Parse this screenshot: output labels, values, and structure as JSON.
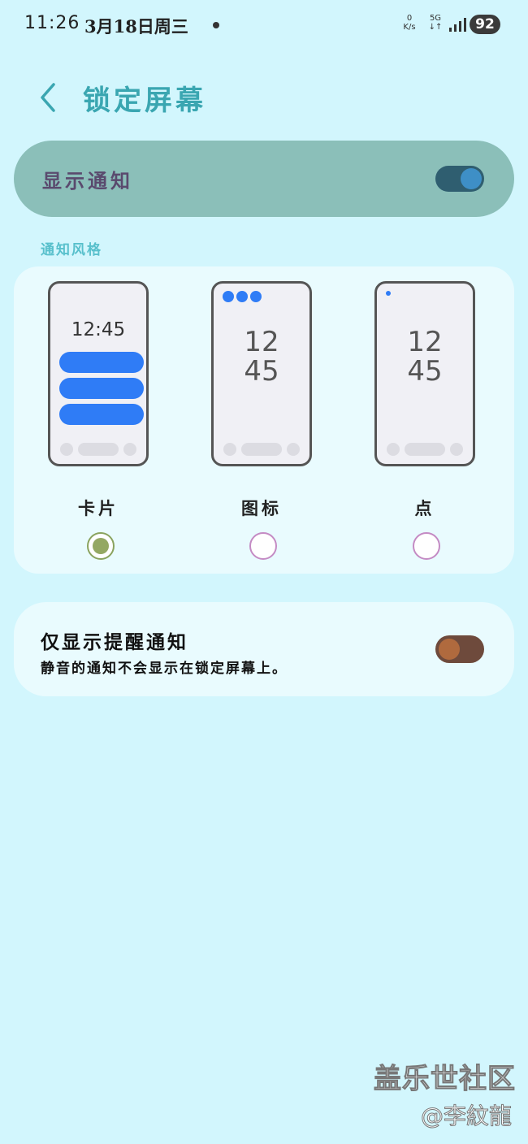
{
  "status_bar": {
    "time": "11:26",
    "date": "3月18日周三",
    "net_speed_value": "0",
    "net_speed_unit": "K/s",
    "network": "5G",
    "battery": "92"
  },
  "header": {
    "back_icon": "chevron-left-icon",
    "title": "锁定屏幕"
  },
  "show_notifications": {
    "label": "显示通知",
    "enabled": true
  },
  "notification_style": {
    "section_label": "通知风格",
    "options": [
      {
        "label": "卡片",
        "clock": "12:45",
        "selected": true
      },
      {
        "label": "图标",
        "clock_hours": "12",
        "clock_minutes": "45",
        "selected": false
      },
      {
        "label": "点",
        "clock_hours": "12",
        "clock_minutes": "45",
        "selected": false
      }
    ]
  },
  "alert_only": {
    "title": "仅显示提醒通知",
    "subtitle": "静音的通知不会显示在锁定屏幕上。",
    "enabled": false
  },
  "watermark": {
    "line1": "盖乐世社区",
    "line2": "@李紋龍"
  },
  "colors": {
    "background": "#d2f6fd",
    "accent": "#3aa6b1",
    "card": "#e9fbfe",
    "blue": "#2f7cf6"
  }
}
